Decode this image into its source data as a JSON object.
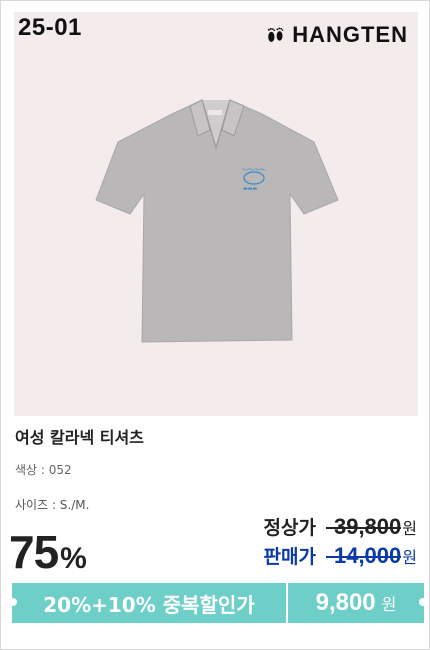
{
  "product": {
    "code": "25-01",
    "brand": "HANGTEN",
    "name": "여성 칼라넥 티셔츠",
    "color_label": "색상",
    "color_value": "052",
    "size_label": "사이즈",
    "size_value": "S./M."
  },
  "pricing": {
    "discount_number": "75",
    "discount_symbol": "%",
    "regular_label": "정상가",
    "regular_price": "39,800",
    "sale_label": "판매가",
    "sale_price": "14,000",
    "currency": "원",
    "promo_text": "20%+10% 중복할인가",
    "final_price": "9,800"
  },
  "colors": {
    "image_bg": "#f4ebed",
    "shirt": "#b9b7b8",
    "promo": "#6ecfc9",
    "sale_blue": "#0a3aa6"
  },
  "icons": {
    "brand_logo": "footprints-icon"
  }
}
